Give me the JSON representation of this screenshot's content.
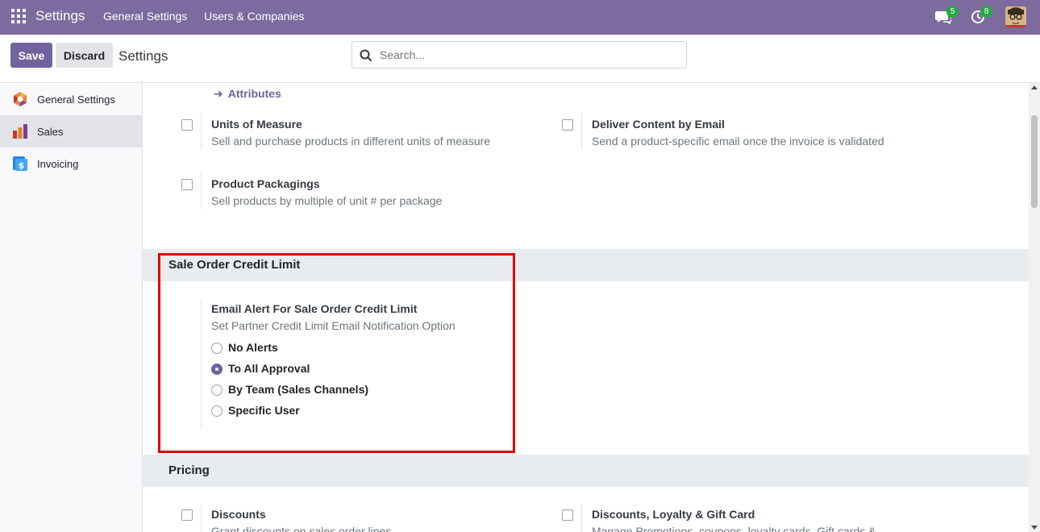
{
  "navbar": {
    "brand": "Settings",
    "menu": [
      "General Settings",
      "Users & Companies"
    ],
    "chat_count": "5",
    "activity_count": "8"
  },
  "control": {
    "save_label": "Save",
    "discard_label": "Discard",
    "title": "Settings",
    "search_placeholder": "Search..."
  },
  "sidebar": {
    "items": [
      {
        "label": "General Settings",
        "icon": "general-settings-icon"
      },
      {
        "label": "Sales",
        "icon": "sales-icon",
        "active": true
      },
      {
        "label": "Invoicing",
        "icon": "invoicing-icon"
      }
    ]
  },
  "main": {
    "attributes_link": "Attributes",
    "settings": [
      {
        "title": "Units of Measure",
        "desc": "Sell and purchase products in different units of measure",
        "checked": false
      },
      {
        "title": "Deliver Content by Email",
        "desc": "Send a product-specific email once the invoice is validated",
        "checked": false
      },
      {
        "title": "Product Packagings",
        "desc": "Sell products by multiple of unit # per package",
        "checked": false
      }
    ],
    "credit_section": {
      "heading": "Sale Order Credit Limit",
      "title": "Email Alert For Sale Order Credit Limit",
      "desc": "Set Partner Credit Limit Email Notification Option",
      "options": [
        "No Alerts",
        "To All Approval",
        "By Team (Sales Channels)",
        "Specific User"
      ],
      "selected": "To All Approval"
    },
    "pricing_section": {
      "heading": "Pricing",
      "settings": [
        {
          "title": "Discounts",
          "desc": "Grant discounts on sales order lines",
          "checked": false
        },
        {
          "title": "Discounts, Loyalty & Gift Card",
          "desc": "Manage Promotions, coupons, loyalty cards, Gift cards &",
          "checked": false
        }
      ]
    }
  },
  "colors": {
    "navbar": "#7c6b9e",
    "primary": "#71639e",
    "badge": "#28a745",
    "highlight": "#e00000"
  }
}
